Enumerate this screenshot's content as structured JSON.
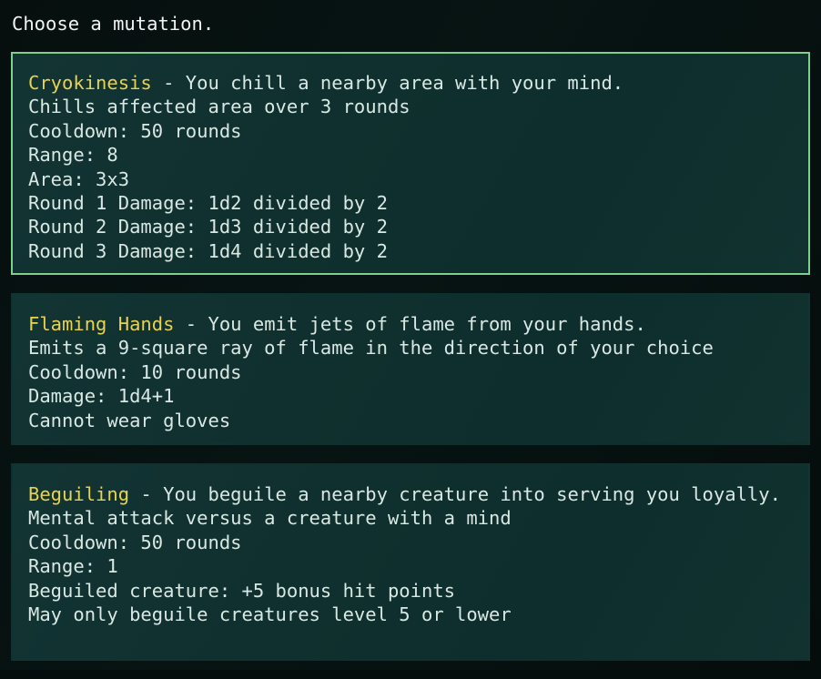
{
  "prompt": {
    "title": "Choose a mutation."
  },
  "selection": {
    "selected_index": 0,
    "selected_border_color": "#7fcf91"
  },
  "colors": {
    "page_background": "#050d0c",
    "card_background": "#11302f",
    "body_text": "#d9e8e3",
    "mutation_name": "#e8d251",
    "title_text": "#f2f4f3",
    "selected_border": "#7fcf91"
  },
  "mutations": [
    {
      "name": "Cryokinesis",
      "separator": " - ",
      "description": "You chill a nearby area with your mind.",
      "selected": true,
      "details": [
        "Chills affected area over 3 rounds",
        "Cooldown: 50 rounds",
        "Range: 8",
        "Area: 3x3",
        "Round 1 Damage: 1d2 divided by 2",
        "Round 2 Damage: 1d3 divided by 2",
        "Round 3 Damage: 1d4 divided by 2"
      ]
    },
    {
      "name": "Flaming Hands",
      "separator": " - ",
      "description": "You emit jets of flame from your hands.",
      "selected": false,
      "details": [
        "Emits a 9-square ray of flame in the direction of your choice",
        "Cooldown: 10 rounds",
        "Damage: 1d4+1",
        "Cannot wear gloves"
      ]
    },
    {
      "name": "Beguiling",
      "separator": " - ",
      "description": "You beguile a nearby creature into serving you loyally.",
      "selected": false,
      "details": [
        "Mental attack versus a creature with a mind",
        "Cooldown: 50 rounds",
        "Range: 1",
        "Beguiled creature: +5 bonus hit points",
        "May only beguile creatures level 5 or lower"
      ]
    }
  ]
}
